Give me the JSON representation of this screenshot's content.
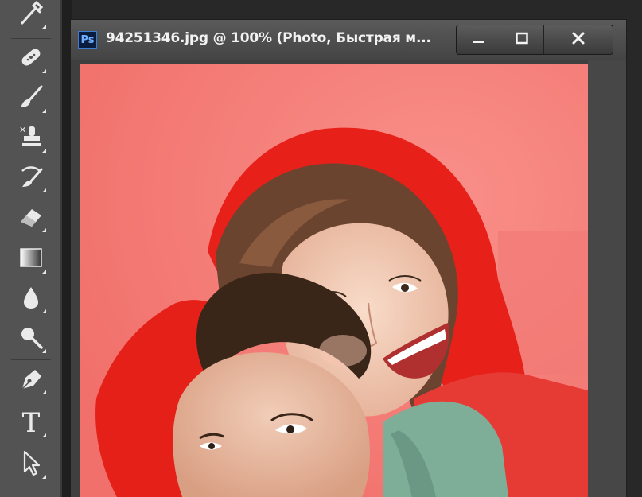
{
  "app": {
    "name": "Photoshop",
    "ps_badge": "Ps"
  },
  "document": {
    "title": "94251346.jpg @ 100% (Photo, Быстрая м..."
  },
  "window_controls": {
    "minimize": "minimize",
    "maximize": "maximize",
    "close": "close"
  },
  "toolbar": {
    "tools": [
      {
        "name": "eyedropper-tool",
        "icon": "eyedropper-icon"
      },
      {
        "name": "spot-healing-tool",
        "icon": "bandage-icon"
      },
      {
        "name": "brush-tool",
        "icon": "brush-icon"
      },
      {
        "name": "clone-stamp-tool",
        "icon": "stamp-icon"
      },
      {
        "name": "history-brush-tool",
        "icon": "history-brush-icon"
      },
      {
        "name": "eraser-tool",
        "icon": "eraser-icon"
      },
      {
        "name": "gradient-tool",
        "icon": "gradient-icon"
      },
      {
        "name": "blur-tool",
        "icon": "drop-icon"
      },
      {
        "name": "dodge-tool",
        "icon": "dodge-icon"
      },
      {
        "name": "pen-tool",
        "icon": "pen-icon"
      },
      {
        "name": "type-tool",
        "icon": "type-icon",
        "glyph": "T"
      },
      {
        "name": "path-selection-tool",
        "icon": "arrow-icon"
      }
    ]
  },
  "colors": {
    "toolbar_bg": "#535353",
    "titlebar_bg": "#4a4a4a",
    "quick_mask_overlay": "#ff0000",
    "canvas_bg": "#f57a74"
  }
}
